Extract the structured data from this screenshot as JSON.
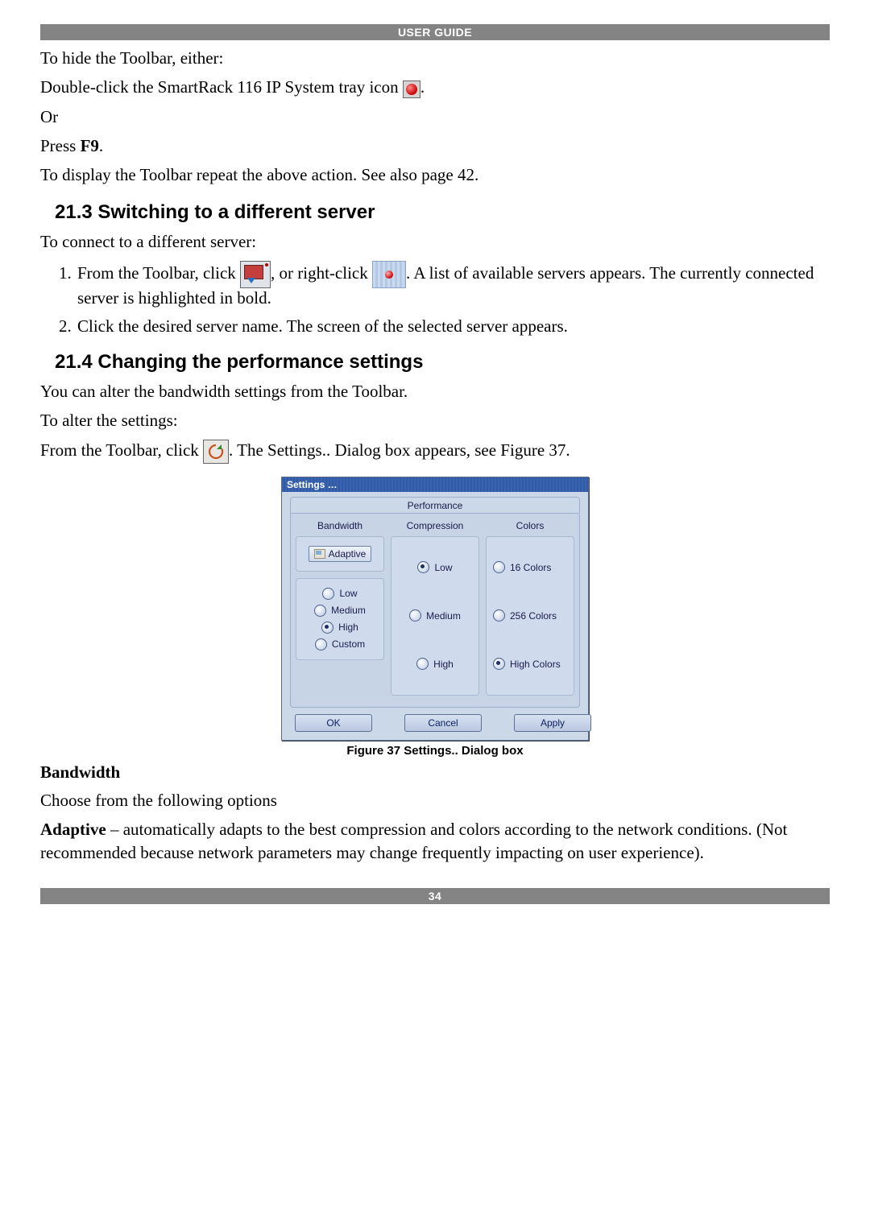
{
  "header": {
    "title": "USER GUIDE"
  },
  "footer": {
    "page_number": "34"
  },
  "body": {
    "p1": "To hide the Toolbar, either:",
    "p2a": "Double-click the SmartRack 116 IP System tray icon ",
    "p2b": ".",
    "p3": "Or",
    "p4a": "Press ",
    "p4b": "F9",
    "p4c": ".",
    "p5": "To display the Toolbar repeat the above action. See also page 42.",
    "h21_3": "21.3 Switching to a different server",
    "p6": "To connect to a different server:",
    "step1a": "From the Toolbar, click ",
    "step1b": ", or right-click ",
    "step1c": ". A list of available servers appears. The currently connected server is highlighted in bold.",
    "step2": "Click the desired server name. The screen of the selected server appears.",
    "h21_4": "21.4 Changing the performance settings",
    "p7": "You can alter the bandwidth settings from the Toolbar.",
    "p8": "To alter the settings:",
    "p9a": "From the Toolbar, click ",
    "p9b": ". The Settings.. Dialog box appears, see Figure 37.",
    "fig_caption": "Figure 37 Settings.. Dialog box",
    "bw_heading": "Bandwidth",
    "p10": "Choose from the following options",
    "p11a": "Adaptive",
    "p11b": " – automatically adapts to the best compression and colors according to the network conditions. (Not recommended because network parameters may change frequently impacting on user experience)."
  },
  "dialog": {
    "title": "Settings …",
    "tab": "Performance",
    "columns": {
      "bandwidth": {
        "label": "Bandwidth",
        "adaptive": "Adaptive",
        "options": [
          "Low",
          "Medium",
          "High",
          "Custom"
        ],
        "selected": "High"
      },
      "compression": {
        "label": "Compression",
        "options": [
          "Low",
          "Medium",
          "High"
        ],
        "selected": "Low"
      },
      "colors": {
        "label": "Colors",
        "options": [
          "16 Colors",
          "256 Colors",
          "High Colors"
        ],
        "selected": "High Colors"
      }
    },
    "buttons": {
      "ok": "OK",
      "cancel": "Cancel",
      "apply": "Apply"
    }
  }
}
